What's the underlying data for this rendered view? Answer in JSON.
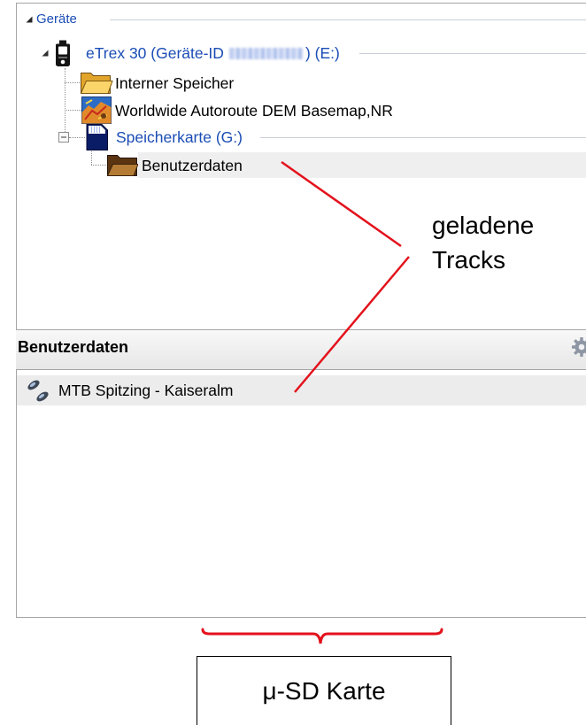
{
  "colors": {
    "tree_link_blue": "#1b4db5",
    "annotation_red": "#e3121c",
    "selected_row": "#efefef",
    "panel_border": "#a6a6a6"
  },
  "device_tree": {
    "label": "Geräte",
    "expanded": true,
    "devices": [
      {
        "label": "eTrex 30 (Geräte-ID",
        "label_suffix": ") (E:)",
        "icon": "gps-device-icon",
        "expanded": true,
        "children": [
          {
            "label": "Interner Speicher",
            "icon": "folder-icon"
          },
          {
            "label": "Worldwide Autoroute DEM Basemap,NR",
            "icon": "map-icon"
          },
          {
            "label": "Speicherkarte (G:)",
            "icon": "sd-card-icon",
            "expanded": true,
            "children": [
              {
                "label": "Benutzerdaten",
                "icon": "folder-icon",
                "selected": true
              }
            ]
          }
        ]
      }
    ]
  },
  "user_data_panel": {
    "title": "Benutzerdaten",
    "settings_icon": "gear-icon",
    "items": [
      {
        "label": "MTB Spitzing - Kaiseralm",
        "icon": "track-icon",
        "selected": true
      }
    ]
  },
  "annotations": {
    "tracks_callout": [
      "geladene",
      "Tracks"
    ],
    "card_label": "μ-SD Karte"
  }
}
